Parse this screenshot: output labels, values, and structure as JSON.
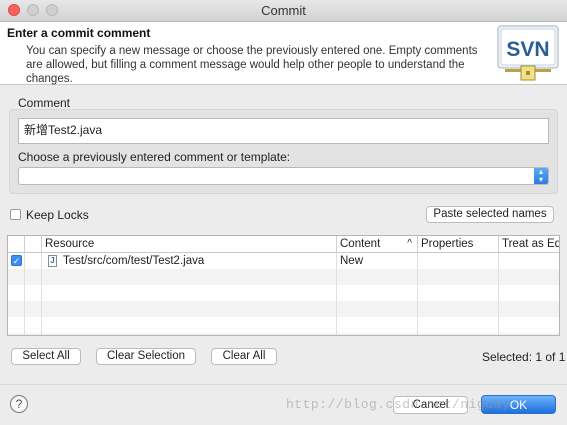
{
  "window": {
    "title": "Commit"
  },
  "header": {
    "title": "Enter a commit comment",
    "description": "You can specify a new message or choose the previously entered one. Empty comments are allowed, but filling a comment message would help other people to understand the changes.",
    "logo_text": "SVN"
  },
  "comment": {
    "group_label": "Comment",
    "value": "新增Test2.java",
    "choose_label": "Choose a previously entered comment or template:",
    "template_value": ""
  },
  "options": {
    "keep_locks_label": "Keep Locks",
    "keep_locks_checked": false,
    "paste_button": "Paste selected names"
  },
  "table": {
    "columns": [
      "Resource",
      "Content",
      "Properties",
      "Treat as Edit"
    ],
    "sort_indicator": "^",
    "rows": [
      {
        "checked": true,
        "resource": "Test/src/com/test/Test2.java",
        "content": "New",
        "properties": "",
        "treat_as_edit": ""
      }
    ]
  },
  "selection": {
    "select_all": "Select All",
    "clear_selection": "Clear Selection",
    "clear_all": "Clear All",
    "status": "Selected: 1 of 1"
  },
  "footer": {
    "help": "?",
    "cancel": "Cancel",
    "ok": "OK",
    "watermark": "http://blog.csdn.net/niguay"
  }
}
